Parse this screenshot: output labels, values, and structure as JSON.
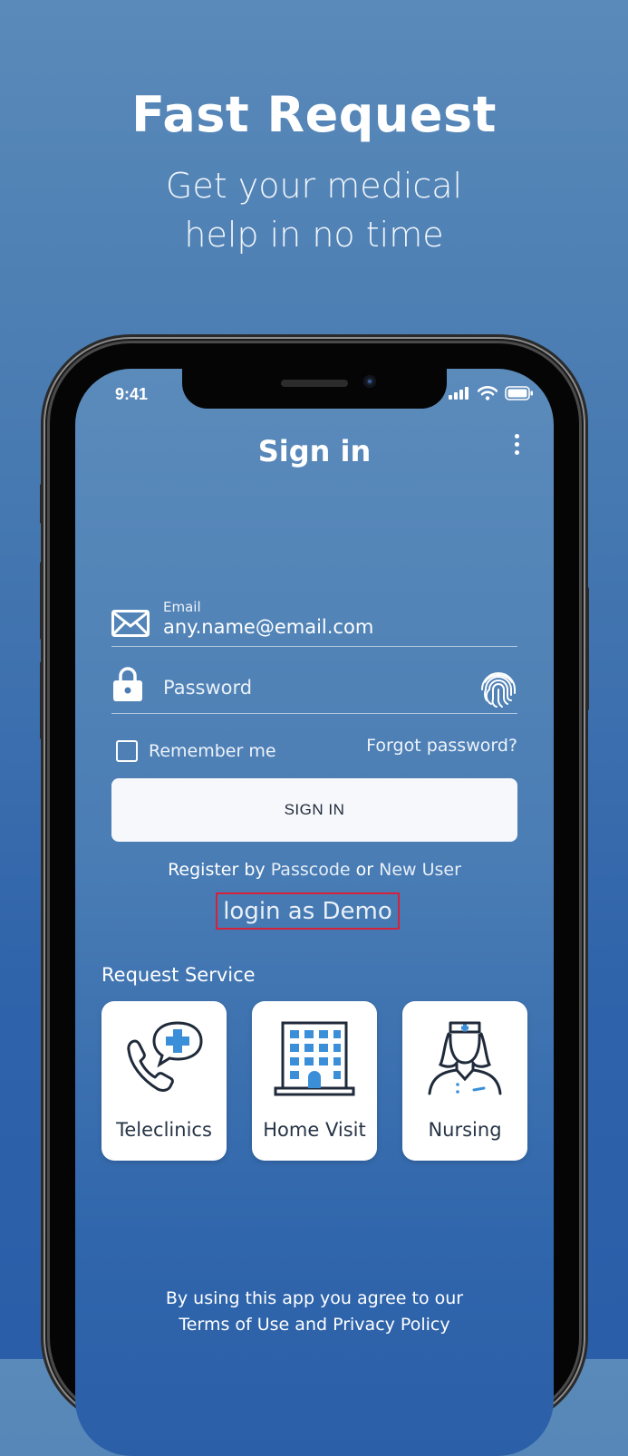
{
  "marketing": {
    "headline": "Fast Request",
    "subline_1": "Get  your medical",
    "subline_2": "help in no time"
  },
  "status_bar": {
    "time": "9:41",
    "icons": [
      "cellular-signal-icon",
      "wifi-icon",
      "battery-icon"
    ]
  },
  "screen": {
    "title": "Sign in",
    "menu_icon": "more-vert-icon"
  },
  "form": {
    "email_label": "Email",
    "email_value": "any.name@email.com",
    "password_placeholder": "Password",
    "remember_label": "Remember me",
    "forgot_label": "Forgot password?",
    "signin_label": "SIGN IN",
    "register_prefix": "Register by",
    "register_passcode": "Passcode",
    "register_or": "or",
    "register_new_user": "New User",
    "demo_label": "login as Demo"
  },
  "request_service": {
    "title": "Request Service",
    "items": [
      {
        "label": "Teleclinics",
        "icon": "phone-chat-medical-icon"
      },
      {
        "label": "Home Visit",
        "icon": "hospital-building-icon"
      },
      {
        "label": "Nursing",
        "icon": "nurse-icon"
      }
    ]
  },
  "footer": {
    "line_1": "By using this app you agree to our",
    "terms": "Terms of Use",
    "and": "and",
    "privacy": "Privacy Policy"
  },
  "colors": {
    "accent_blue": "#3b8fd9",
    "demo_highlight": "#d6213a",
    "card_text": "#263446"
  }
}
